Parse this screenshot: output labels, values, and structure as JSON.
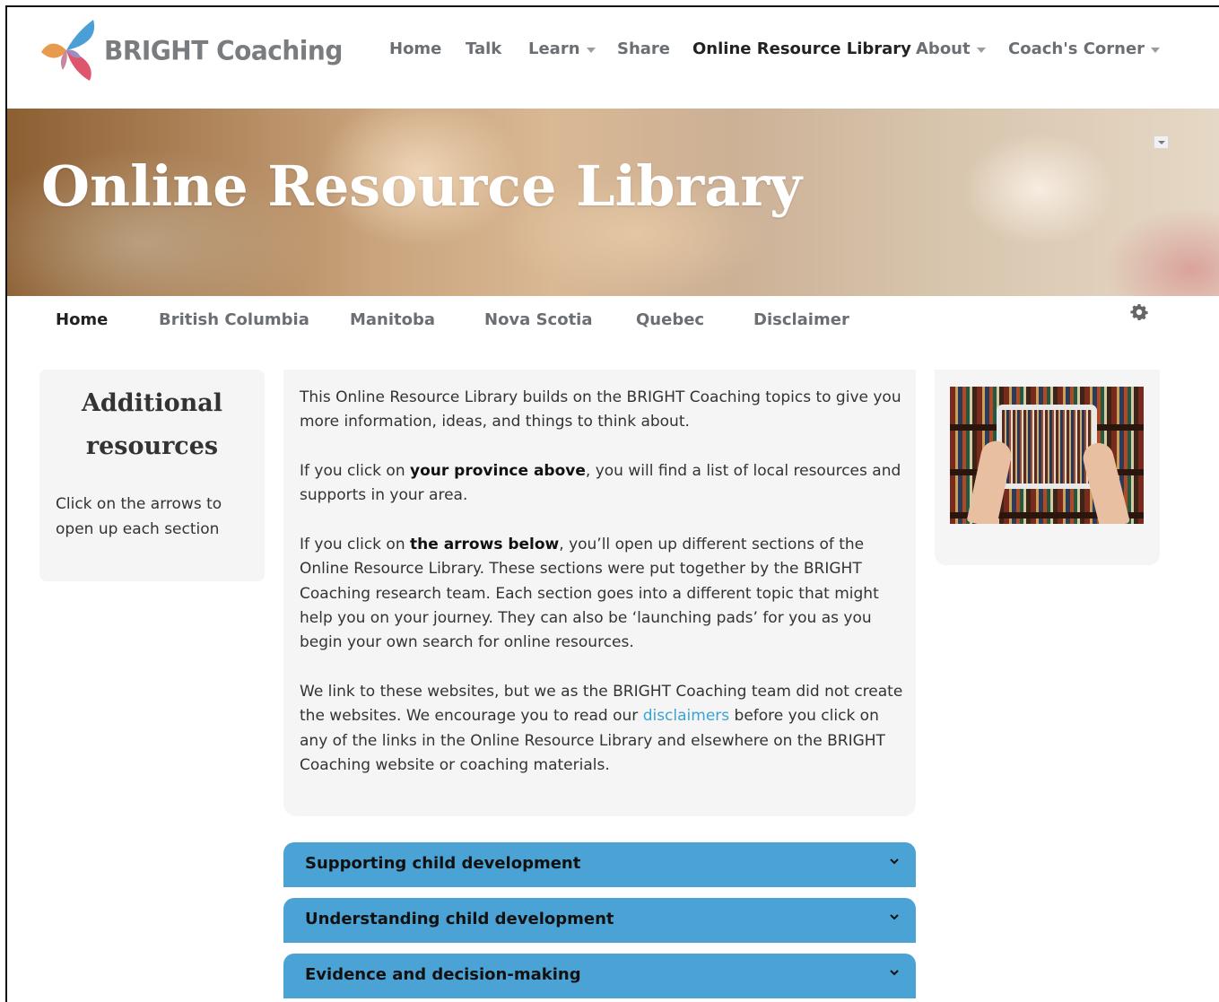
{
  "brand": {
    "name": "BRIGHT Coaching",
    "logo_colors": [
      "#4a9fd6",
      "#e89a4e",
      "#e0556e",
      "#9b8dbf"
    ]
  },
  "nav": {
    "items": [
      {
        "label": "Home",
        "active": false,
        "has_dropdown": false
      },
      {
        "label": "Talk",
        "active": false,
        "has_dropdown": false
      },
      {
        "label": "Learn",
        "active": false,
        "has_dropdown": true
      },
      {
        "label": "Share",
        "active": false,
        "has_dropdown": false
      },
      {
        "label": "Online Resource Library",
        "active": true,
        "has_dropdown": false
      },
      {
        "label": "About",
        "active": false,
        "has_dropdown": true
      },
      {
        "label": "Coach's Corner",
        "active": false,
        "has_dropdown": true
      }
    ]
  },
  "banner": {
    "title": "Online Resource Library",
    "dropdown_icon": "chevron-down-icon"
  },
  "subnav": {
    "items": [
      {
        "label": "Home",
        "active": true
      },
      {
        "label": "British Columbia",
        "active": false
      },
      {
        "label": "Manitoba",
        "active": false
      },
      {
        "label": "Nova Scotia",
        "active": false
      },
      {
        "label": "Quebec",
        "active": false
      },
      {
        "label": "Disclaimer",
        "active": false
      }
    ],
    "settings_icon": "gear-icon"
  },
  "sidebar": {
    "heading_line1": "Additional",
    "heading_line2": "resources",
    "text": "Click on the arrows to open up each section"
  },
  "main": {
    "p1": "This Online Resource Library builds on the BRIGHT Coaching topics to give you more information, ideas, and things to think about.",
    "p2_pre": "If you click on ",
    "p2_bold": "your province above",
    "p2_post": ", you will find a list of local resources and supports in your area.",
    "p3_pre": "If you click on ",
    "p3_bold": "the arrows below",
    "p3_post": ", you’ll open up different sections of the Online Resource Library. These sections were put together by the BRIGHT Coaching research team. Each section goes into a different topic that might help you on your journey. They can also be ‘launching pads’ for you as you begin your own search for online resources.",
    "p4_pre": "We link to these websites, but we as the BRIGHT Coaching team did not create the websites. We encourage you to read our ",
    "p4_link": "disclaimers",
    "p4_post": " before you click on any of the links in the Online Resource Library and elsewhere on the BRIGHT Coaching website or coaching materials."
  },
  "right_panel": {
    "image": "library-tablet-image"
  },
  "accordions": [
    {
      "label": "Supporting child development"
    },
    {
      "label": "Understanding child development"
    },
    {
      "label": "Evidence and decision-making"
    }
  ],
  "colors": {
    "accent": "#4ba3d5",
    "link": "#3aa3d3",
    "card_bg": "#f5f5f5",
    "nav_text": "#6b6f74"
  }
}
